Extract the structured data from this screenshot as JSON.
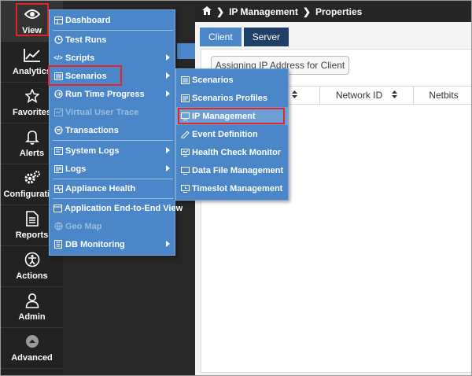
{
  "nav": {
    "items": [
      {
        "label": "View",
        "icon": "eye-icon"
      },
      {
        "label": "Analytics",
        "icon": "line-chart-icon"
      },
      {
        "label": "Favorites",
        "icon": "star-icon"
      },
      {
        "label": "Alerts",
        "icon": "bell-icon"
      },
      {
        "label": "Configuration",
        "icon": "gears-icon"
      },
      {
        "label": "Reports",
        "icon": "document-icon"
      },
      {
        "label": "Actions",
        "icon": "accessibility-icon"
      },
      {
        "label": "Admin",
        "icon": "user-icon"
      },
      {
        "label": "Advanced",
        "icon": "chevron-up-circle-icon"
      }
    ]
  },
  "breadcrumb": {
    "home_icon": "home-icon",
    "section": "IP Management",
    "page": "Properties"
  },
  "tabs": {
    "client": "Client",
    "server": "Server"
  },
  "assign_button": "Assigning IP Address for Client",
  "table": {
    "headers": [
      "",
      "Network ID",
      "Netbits"
    ]
  },
  "view_menu": {
    "items": [
      {
        "label": "Dashboard",
        "icon": "dashboard-icon"
      },
      {
        "label": "Test Runs",
        "icon": "clock-icon"
      },
      {
        "label": "Scripts",
        "icon": "code-icon"
      },
      {
        "label": "Scenarios",
        "icon": "scenario-icon"
      },
      {
        "label": "Run Time Progress",
        "icon": "progress-icon"
      },
      {
        "label": "Virtual User Trace",
        "icon": "trace-icon"
      },
      {
        "label": "Transactions",
        "icon": "transactions-icon"
      },
      {
        "label": "System Logs",
        "icon": "system-logs-icon"
      },
      {
        "label": "Logs",
        "icon": "logs-icon"
      },
      {
        "label": "Appliance Health",
        "icon": "health-icon"
      },
      {
        "label": "Application End-to-End View",
        "icon": "end-to-end-icon"
      },
      {
        "label": "Geo Map",
        "icon": "geo-map-icon"
      },
      {
        "label": "DB Monitoring",
        "icon": "db-icon"
      }
    ]
  },
  "scenarios_menu": {
    "items": [
      {
        "label": "Scenarios",
        "icon": "scenario-icon"
      },
      {
        "label": "Scenarios Profiles",
        "icon": "profile-icon"
      },
      {
        "label": "IP Management",
        "icon": "ip-icon"
      },
      {
        "label": "Event Definition",
        "icon": "event-icon"
      },
      {
        "label": "Health Check Monitor",
        "icon": "monitor-icon"
      },
      {
        "label": "Data File Management",
        "icon": "file-icon"
      },
      {
        "label": "Timeslot Management",
        "icon": "timeslot-icon"
      }
    ]
  },
  "colors": {
    "highlight": "#e0242a",
    "menu": "#4a86c8",
    "nav": "#222222"
  }
}
